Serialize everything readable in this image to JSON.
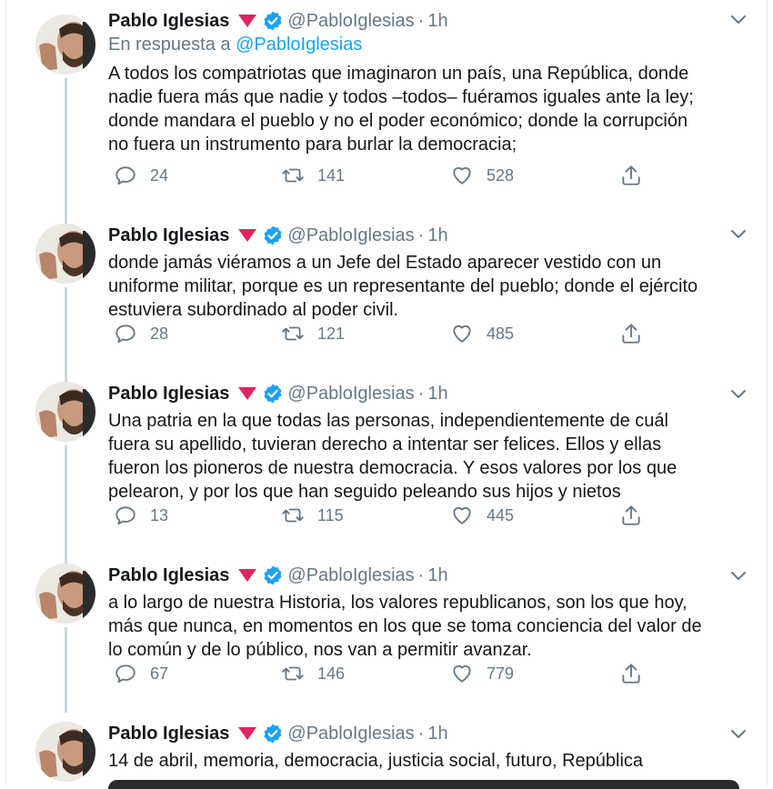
{
  "tweets": [
    {
      "name": "Pablo Iglesias",
      "handle": "@PabloIglesias",
      "time": "1h",
      "reply_prefix": "En respuesta a",
      "reply_mention": "@PabloIglesias",
      "lines": [
        "A todos los compatriotas que imaginaron un país, una República, donde",
        "nadie fuera más que nadie y todos –todos– fuéramos iguales ante la ley;",
        "donde mandara el pueblo y no el poder económico; donde la corrupción",
        "no fuera un instrumento para burlar la democracia;"
      ],
      "replies": "24",
      "retweets": "141",
      "likes": "528"
    },
    {
      "name": "Pablo Iglesias",
      "handle": "@PabloIglesias",
      "time": "1h",
      "lines": [
        "donde jamás viéramos a un Jefe del Estado aparecer vestido con un",
        "uniforme militar, porque es un representante del pueblo; donde el ejército",
        "estuviera subordinado al poder civil."
      ],
      "replies": "28",
      "retweets": "121",
      "likes": "485"
    },
    {
      "name": "Pablo Iglesias",
      "handle": "@PabloIglesias",
      "time": "1h",
      "lines": [
        "Una patria en la que todas las personas, independientemente de cuál",
        "fuera su apellido, tuvieran derecho a intentar ser felices. Ellos y ellas",
        "fueron los pioneros de nuestra democracia. Y esos valores por los que",
        "pelearon, y por los que han seguido peleando sus hijos y nietos"
      ],
      "replies": "13",
      "retweets": "115",
      "likes": "445"
    },
    {
      "name": "Pablo Iglesias",
      "handle": "@PabloIglesias",
      "time": "1h",
      "lines": [
        "a lo largo de nuestra Historia, los valores republicanos, son los que hoy,",
        "más que nunca, en momentos en los que se toma conciencia del valor de",
        "lo común y de lo público, nos van a permitir avanzar."
      ],
      "replies": "67",
      "retweets": "146",
      "likes": "779"
    },
    {
      "name": "Pablo Iglesias",
      "handle": "@PabloIglesias",
      "time": "1h",
      "lines": [
        "14 de abril, memoria, democracia, justicia social, futuro, República"
      ]
    }
  ],
  "icons": {
    "reply": "reply-icon",
    "retweet": "retweet-icon",
    "like": "heart-icon",
    "share": "share-icon",
    "verified": "verified-badge-icon",
    "caret": "chevron-down-icon",
    "flag": "red-triangle-icon"
  },
  "colors": {
    "link": "#1da1f2",
    "muted": "#657786",
    "verified": "#1da1f2",
    "triangle": "#e0245e",
    "thread_line": "#ccd6dd"
  }
}
